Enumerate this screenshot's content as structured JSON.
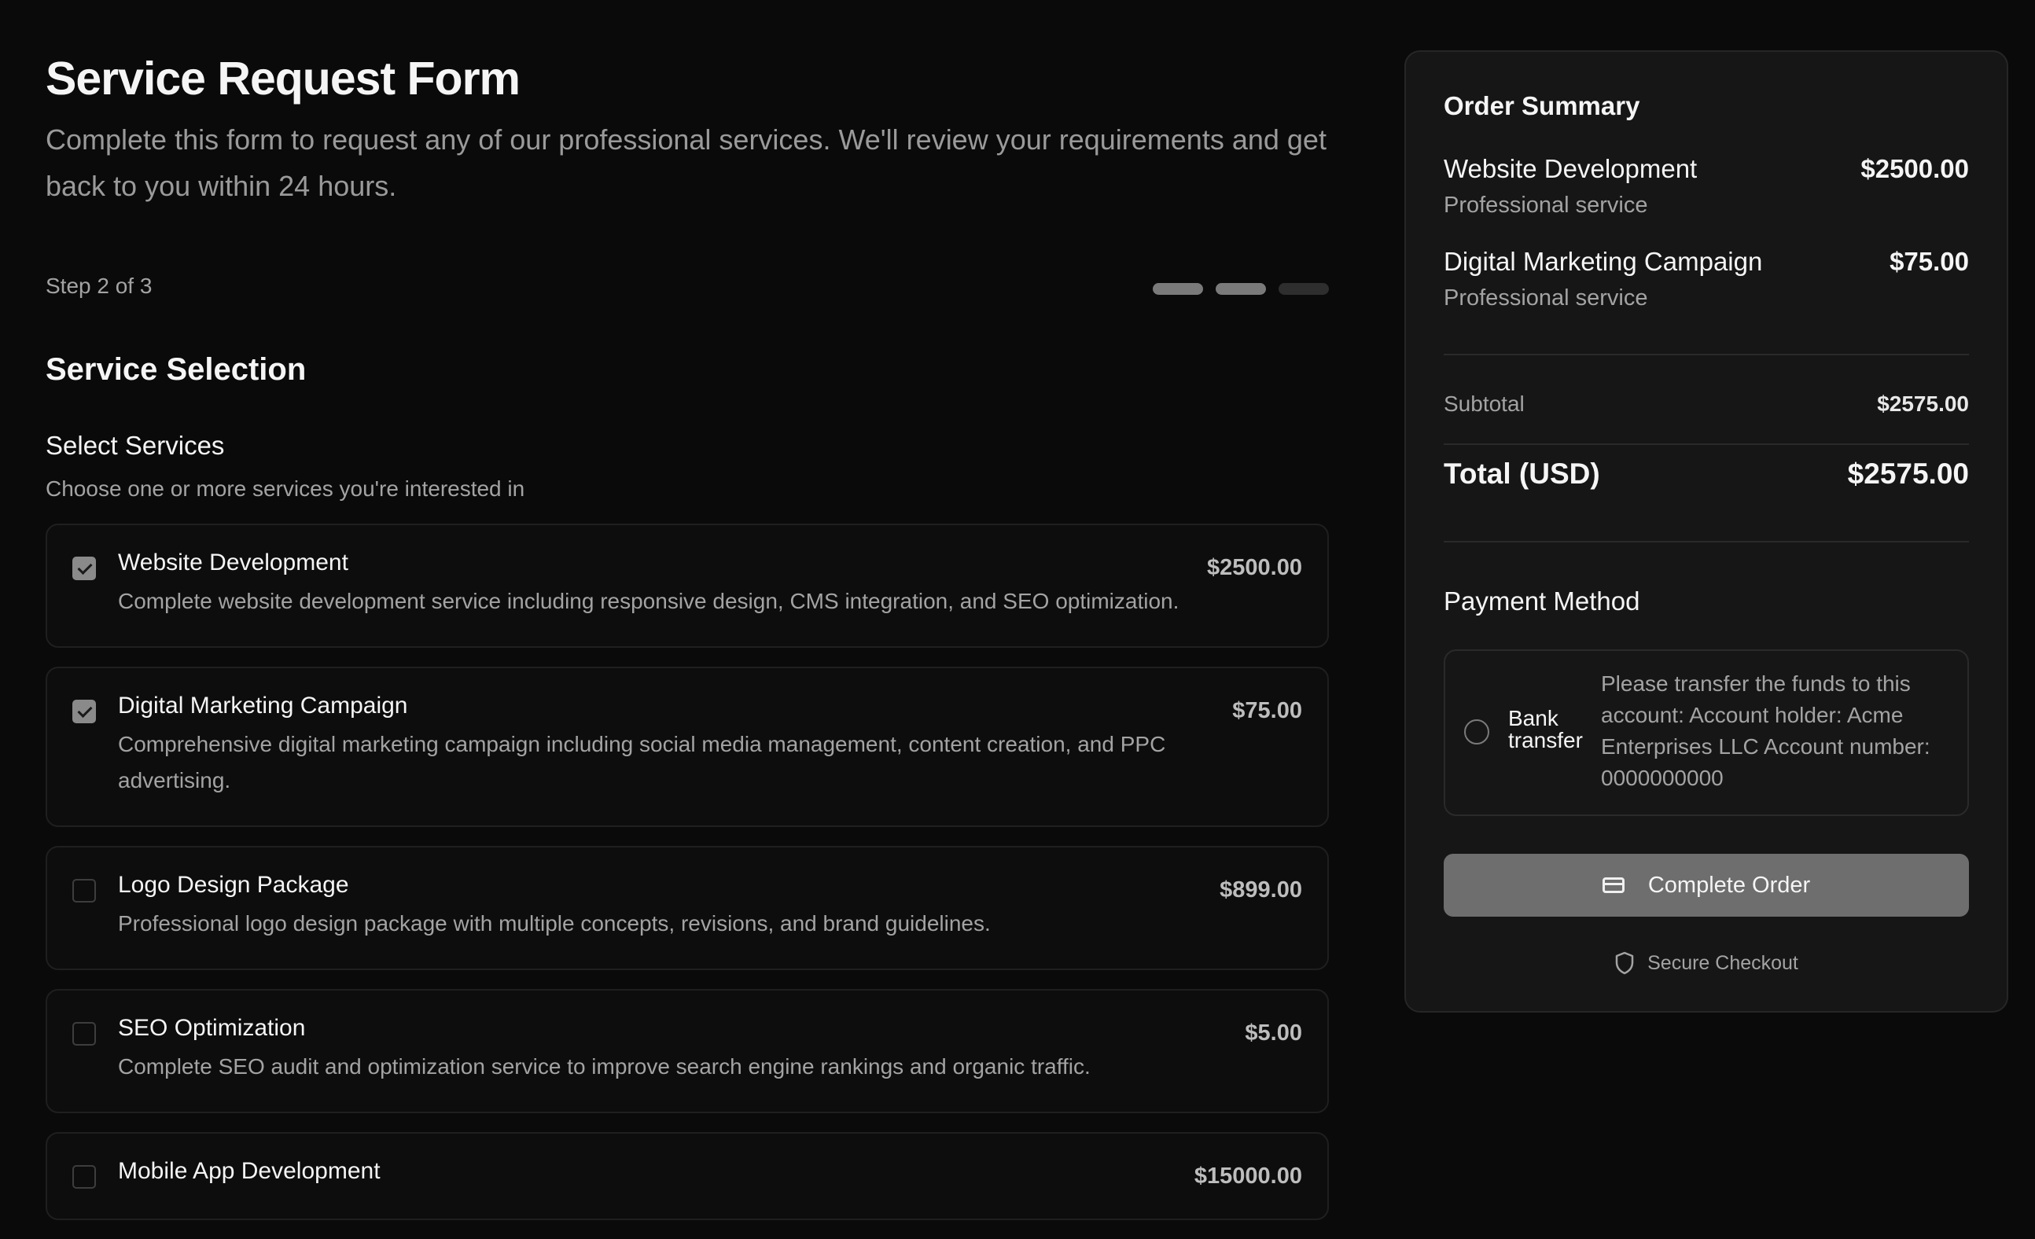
{
  "header": {
    "title": "Service Request Form",
    "description": "Complete this form to request any of our professional services. We'll review your requirements and get back to you within 24 hours."
  },
  "progress": {
    "label": "Step 2 of 3",
    "current_step": 2,
    "total_steps": 3
  },
  "section": {
    "title": "Service Selection",
    "group_title": "Select Services",
    "group_description": "Choose one or more services you're interested in"
  },
  "services": [
    {
      "name": "Website Development",
      "description": "Complete website development service including responsive design, CMS integration, and SEO optimization.",
      "price": "$2500.00",
      "checked": true
    },
    {
      "name": "Digital Marketing Campaign",
      "description": "Comprehensive digital marketing campaign including social media management, content creation, and PPC advertising.",
      "price": "$75.00",
      "checked": true
    },
    {
      "name": "Logo Design Package",
      "description": "Professional logo design package with multiple concepts, revisions, and brand guidelines.",
      "price": "$899.00",
      "checked": false
    },
    {
      "name": "SEO Optimization",
      "description": "Complete SEO audit and optimization service to improve search engine rankings and organic traffic.",
      "price": "$5.00",
      "checked": false
    },
    {
      "name": "Mobile App Development",
      "description": "",
      "price": "$15000.00",
      "checked": false
    }
  ],
  "summary": {
    "title": "Order Summary",
    "items": [
      {
        "name": "Website Development",
        "subtitle": "Professional service",
        "price": "$2500.00"
      },
      {
        "name": "Digital Marketing Campaign",
        "subtitle": "Professional service",
        "price": "$75.00"
      }
    ],
    "subtotal_label": "Subtotal",
    "subtotal_value": "$2575.00",
    "total_label": "Total (USD)",
    "total_value": "$2575.00",
    "payment_title": "Payment Method",
    "payment_option_label": "Bank transfer",
    "payment_option_detail": "Please transfer the funds to this account: Account holder: Acme Enterprises LLC Account number: 0000000000",
    "complete_button": "Complete Order",
    "secure_label": "Secure Checkout"
  },
  "icons": {
    "card": "credit-card-icon",
    "shield": "shield-icon",
    "check": "check-icon"
  }
}
